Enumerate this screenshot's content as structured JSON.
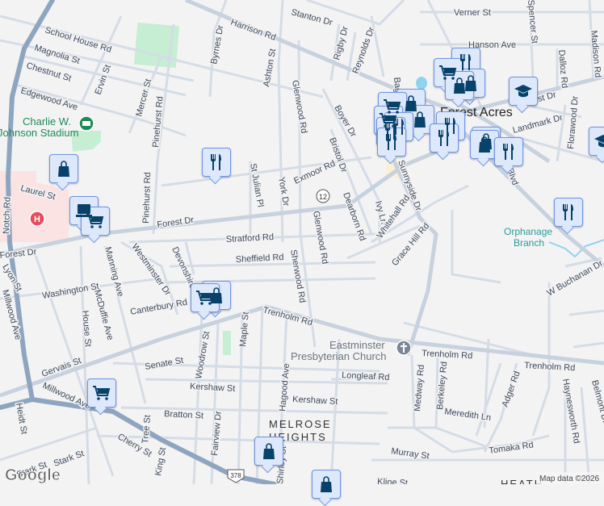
{
  "map": {
    "neighborhoods": {
      "forest_acres": "Forest Acres",
      "melrose": "MELROSE",
      "heights": "HEIGHTS",
      "heath": "HEATH"
    },
    "pois": {
      "stadium_line1": "Charlie W.",
      "stadium_line2": "Johnson Stadium",
      "church_line1": "Eastminster",
      "church_line2": "Presbyterian Church",
      "library_line1": "Orphanage",
      "library_line2": "Branch"
    },
    "route_shields": [
      "12",
      "378"
    ],
    "streets": [
      "School House Rd",
      "Magnolia St",
      "Chestnut St",
      "Edgewood Ave",
      "Ervin St",
      "Mercer St",
      "Pinehurst Rd",
      "Pinehurst Rd",
      "Byrnes Dr",
      "Harrison Rd",
      "Ashton St",
      "Stanton Dr",
      "Glenwood Rd",
      "Rigby Dr",
      "Reynolds Dr",
      "Boyer Dr",
      "Bristol Dr",
      "Exmoor Rd",
      "St Julian Pl",
      "York Dr",
      "Laurel St",
      "Forest Dr",
      "Forest Dr",
      "Stratford Rd",
      "Glenwood Rd",
      "Dearborn Rd",
      "Ivy Ln",
      "Whitehall Rd",
      "Sunnyside Dr",
      "Grace Hill Rd",
      "Sheffield Rd",
      "Sherwood Rd",
      "Devonshire",
      "Westminster Dr",
      "Manning Ave",
      "Lyon St",
      "Washington St",
      "McDuffie Ave",
      "House St",
      "Canterbury Rd",
      "Trenholm Rd",
      "Gervais St",
      "Senate St",
      "Woodrow St",
      "Maple St",
      "Kershaw St",
      "Millwood Ave",
      "Heidt St",
      "Tree St",
      "Bratton St",
      "Fairview Dr",
      "Hagood Ave",
      "Kershaw St",
      "Cherry St",
      "Stark St",
      "Stark St",
      "King St",
      "Longleaf Rd",
      "Medway Rd",
      "Berkeley Rd",
      "Meredith Ln",
      "Adger Rd",
      "Trenholm Rd",
      "Trenholm Rd",
      "Haynesworth Rd",
      "Belmont Dr",
      "Tomaka Rd",
      "Murray St",
      "Kline St",
      "W Buchanan Dr",
      "Verner St",
      "Hanson Ave",
      "Spencer St",
      "Dalloz Rd",
      "Madison Rd",
      "Florawood Dr",
      "Landmark Dr",
      "Forest Dr",
      "Sunnyside Dr",
      "Shirley St",
      "Notch Rd",
      "Millwood Ave",
      "Bagby",
      "Blvd"
    ],
    "attribution": "Map data ©2026",
    "logo": "Google",
    "colors": {
      "marker_fill": "#dde8fb",
      "marker_border": "#6e95e6",
      "icon": "#08426a",
      "major_road": "#8ea5c0",
      "road": "#cfd8e3",
      "park": "#c6eed3",
      "hospital_area": "#fbe3e3",
      "water": "#8fd4ee"
    }
  }
}
